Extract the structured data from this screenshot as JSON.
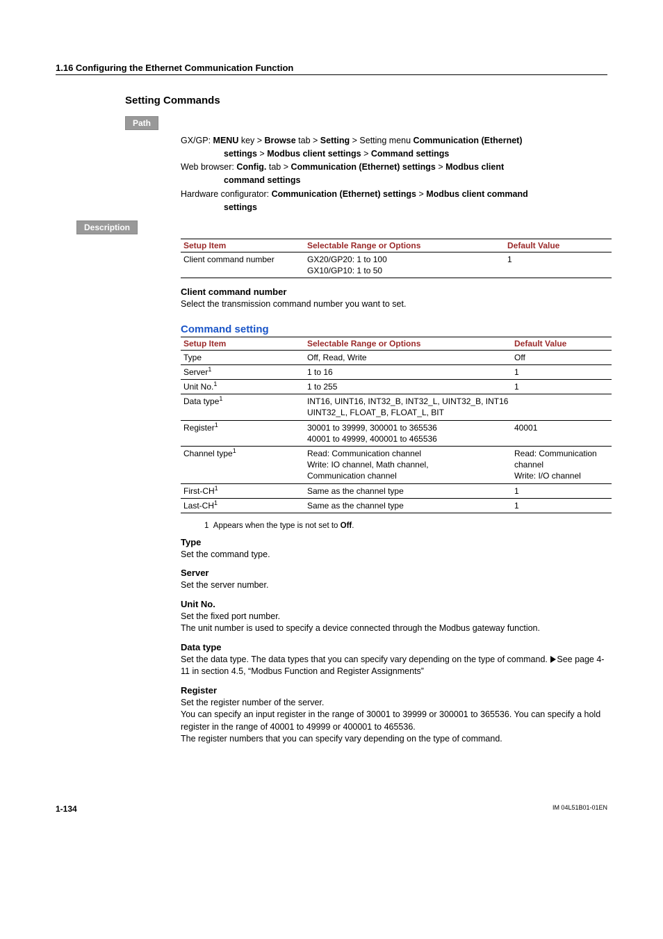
{
  "section_header": "1.16  Configuring the Ethernet Communication Function",
  "heading": "Setting Commands",
  "labels": {
    "path": "Path",
    "description": "Description"
  },
  "path": {
    "line1": {
      "prefix": "GX/GP: ",
      "b1": "MENU",
      "t1": " key > ",
      "b2": "Browse",
      "t2": " tab > ",
      "b3": "Setting",
      "t3": " > Setting menu ",
      "b4": "Communication (Ethernet) "
    },
    "line1b": {
      "b1": "settings",
      "t1": " > ",
      "b2": "Modbus client settings",
      "t2": " > ",
      "b3": "Command settings"
    },
    "line2": {
      "prefix": "Web browser: ",
      "b1": "Config.",
      "t1": " tab > ",
      "b2": "Communication (Ethernet) settings",
      "t2": " > ",
      "b3": "Modbus client "
    },
    "line2b": {
      "b1": "command settings"
    },
    "line3": {
      "prefix": "Hardware configurator: ",
      "b1": "Communication (Ethernet) settings",
      "t1": " > ",
      "b2": "Modbus client command "
    },
    "line3b": {
      "b1": "settings"
    }
  },
  "table1": {
    "headers": [
      "Setup Item",
      "Selectable Range or Options",
      "Default Value"
    ],
    "rows": [
      {
        "c1": "Client command number",
        "c2": "GX20/GP20: 1 to 100\nGX10/GP10: 1 to 50",
        "c3": "1"
      }
    ]
  },
  "ccn": {
    "title": "Client command number",
    "body": "Select the transmission command number you want to set."
  },
  "command_setting_title": "Command setting",
  "table2": {
    "headers": [
      "Setup Item",
      "Selectable Range or Options",
      "Default Value"
    ],
    "rows": [
      {
        "c1": "Type",
        "sup": "",
        "c2": "Off, Read, Write",
        "c3": "Off"
      },
      {
        "c1": "Server",
        "sup": "1",
        "c2": "1 to 16",
        "c3": "1"
      },
      {
        "c1": "Unit No.",
        "sup": "1",
        "c2": "1 to 255",
        "c3": "1"
      },
      {
        "c1": "Data type",
        "sup": "1",
        "c2": "INT16, UINT16, INT32_B, INT32_L, UINT32_B, INT16\nUINT32_L, FLOAT_B, FLOAT_L, BIT",
        "c3": ""
      },
      {
        "c1": "Register",
        "sup": "1",
        "c2": "30001 to 39999, 300001 to 365536\n40001 to 49999, 400001 to 465536",
        "c3": "40001"
      },
      {
        "c1": "Channel type",
        "sup": "1",
        "c2": "Read: Communication channel\nWrite: IO channel, Math channel,\nCommunication channel",
        "c3": "Read: Communication channel\nWrite: I/O channel"
      },
      {
        "c1": "First-CH",
        "sup": "1",
        "c2": "Same as the channel type",
        "c3": "1"
      },
      {
        "c1": "Last-CH",
        "sup": "1",
        "c2": "Same as the channel type",
        "c3": "1"
      }
    ]
  },
  "footnote": {
    "num": "1",
    "txt1": "Appears when the type is not set to ",
    "b": "Off",
    "txt2": "."
  },
  "items": {
    "type": {
      "h": "Type",
      "b": "Set the command type."
    },
    "server": {
      "h": "Server",
      "b": "Set the server number."
    },
    "unit": {
      "h": "Unit No.",
      "b": "Set the fixed port number.\nThe unit number is used to specify a device connected through the Modbus gateway function."
    },
    "data_type": {
      "h": "Data type",
      "pre": "Set the data type. The data types that you can specify vary depending on the type of command. ",
      "post": "See page 4-11 in section 4.5, “Modbus Function and Register Assignments”"
    },
    "register": {
      "h": "Register",
      "b": "Set the register number of the server.\nYou can specify an input register in the range of 30001 to 39999 or 300001 to 365536. You can specify a hold register in the range of 40001 to 49999 or 400001 to 465536.\nThe register numbers that you can specify vary depending on the type of command."
    }
  },
  "footer": {
    "left": "1-134",
    "right": "IM 04L51B01-01EN"
  }
}
